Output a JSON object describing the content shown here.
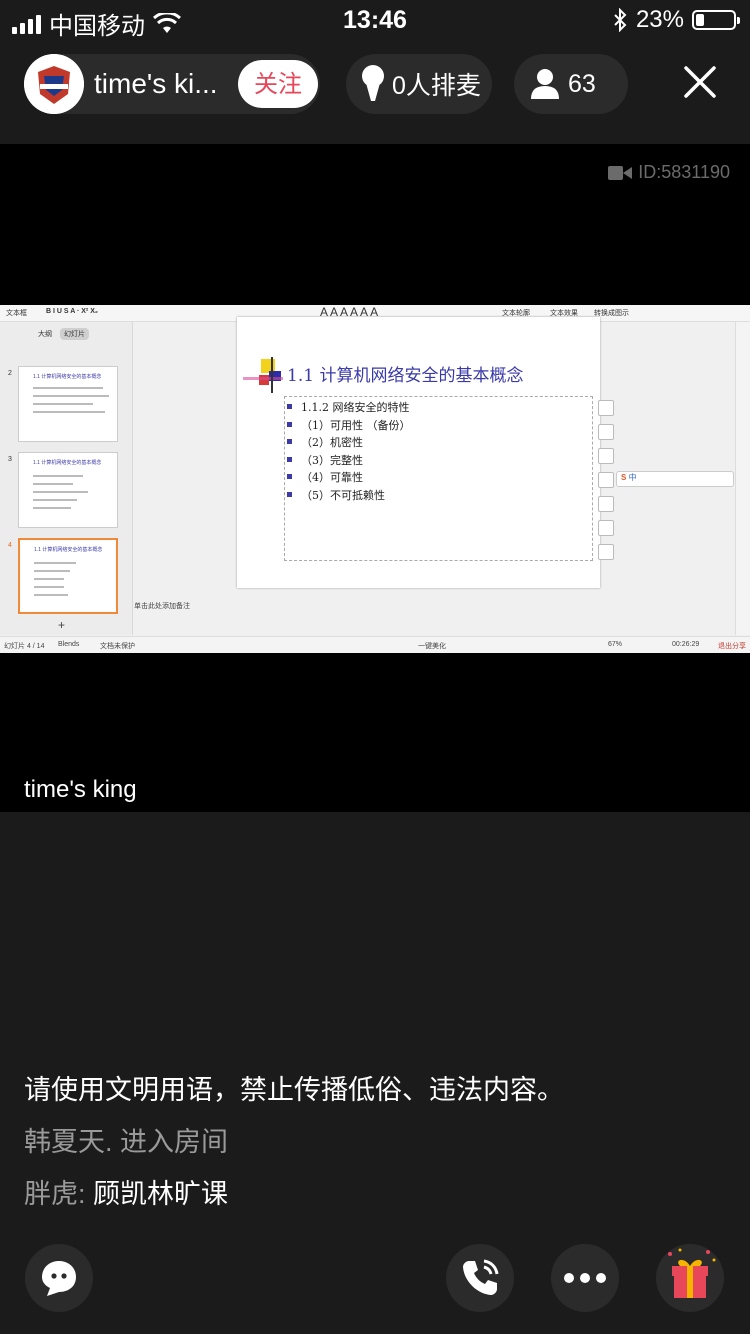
{
  "status_bar": {
    "carrier": "中国移动",
    "time": "13:46",
    "battery": "23%",
    "battery_level": 0.23
  },
  "header": {
    "host_name": "time's ki...",
    "follow_label": "关注",
    "queue_label": "0人排麦",
    "viewer_count": "63"
  },
  "video": {
    "room_id": "ID:5831190",
    "host_label": "time's king",
    "ppt": {
      "toolbar_left": "文本框",
      "toolbar_items": [
        "文本轮廓",
        "文本效果",
        "转换成图示"
      ],
      "tabs": [
        "大纲",
        "幻灯片"
      ],
      "thumbnails": [
        {
          "num": "2",
          "title": "1.1 计算机网络安全的基本概念"
        },
        {
          "num": "3",
          "title": "1.1 计算机网络安全的基本概念"
        },
        {
          "num": "4",
          "title": "1.1 计算机网络安全的基本概念"
        }
      ],
      "slide_title": "1.1  计算机网络安全的基本概念",
      "bullets": [
        "1.1.2  网络安全的特性",
        "（1）可用性 （备份）",
        "（2）机密性",
        "（3）完整性",
        "（4）可靠性",
        "（5）不可抵赖性"
      ],
      "notes": "单击此处添加备注",
      "status_left": "幻灯片 4 / 14",
      "status_theme": "Blends",
      "status_protect": "文档未保护",
      "status_beautify": "一键美化",
      "zoom": "67%",
      "timer": "00:26:29",
      "exit_share": "退出分享",
      "ime_label": "中"
    }
  },
  "chat": [
    {
      "type": "notice",
      "text": "请使用文明用语，禁止传播低俗、违法内容。"
    },
    {
      "type": "system",
      "text": "韩夏天. 进入房间"
    },
    {
      "type": "message",
      "sender": "胖虎:",
      "text": "顾凯林旷课"
    }
  ],
  "bottom_bar": {
    "icons": [
      "chat-bubble-icon",
      "phone-call-icon",
      "more-icon",
      "gift-icon"
    ]
  }
}
